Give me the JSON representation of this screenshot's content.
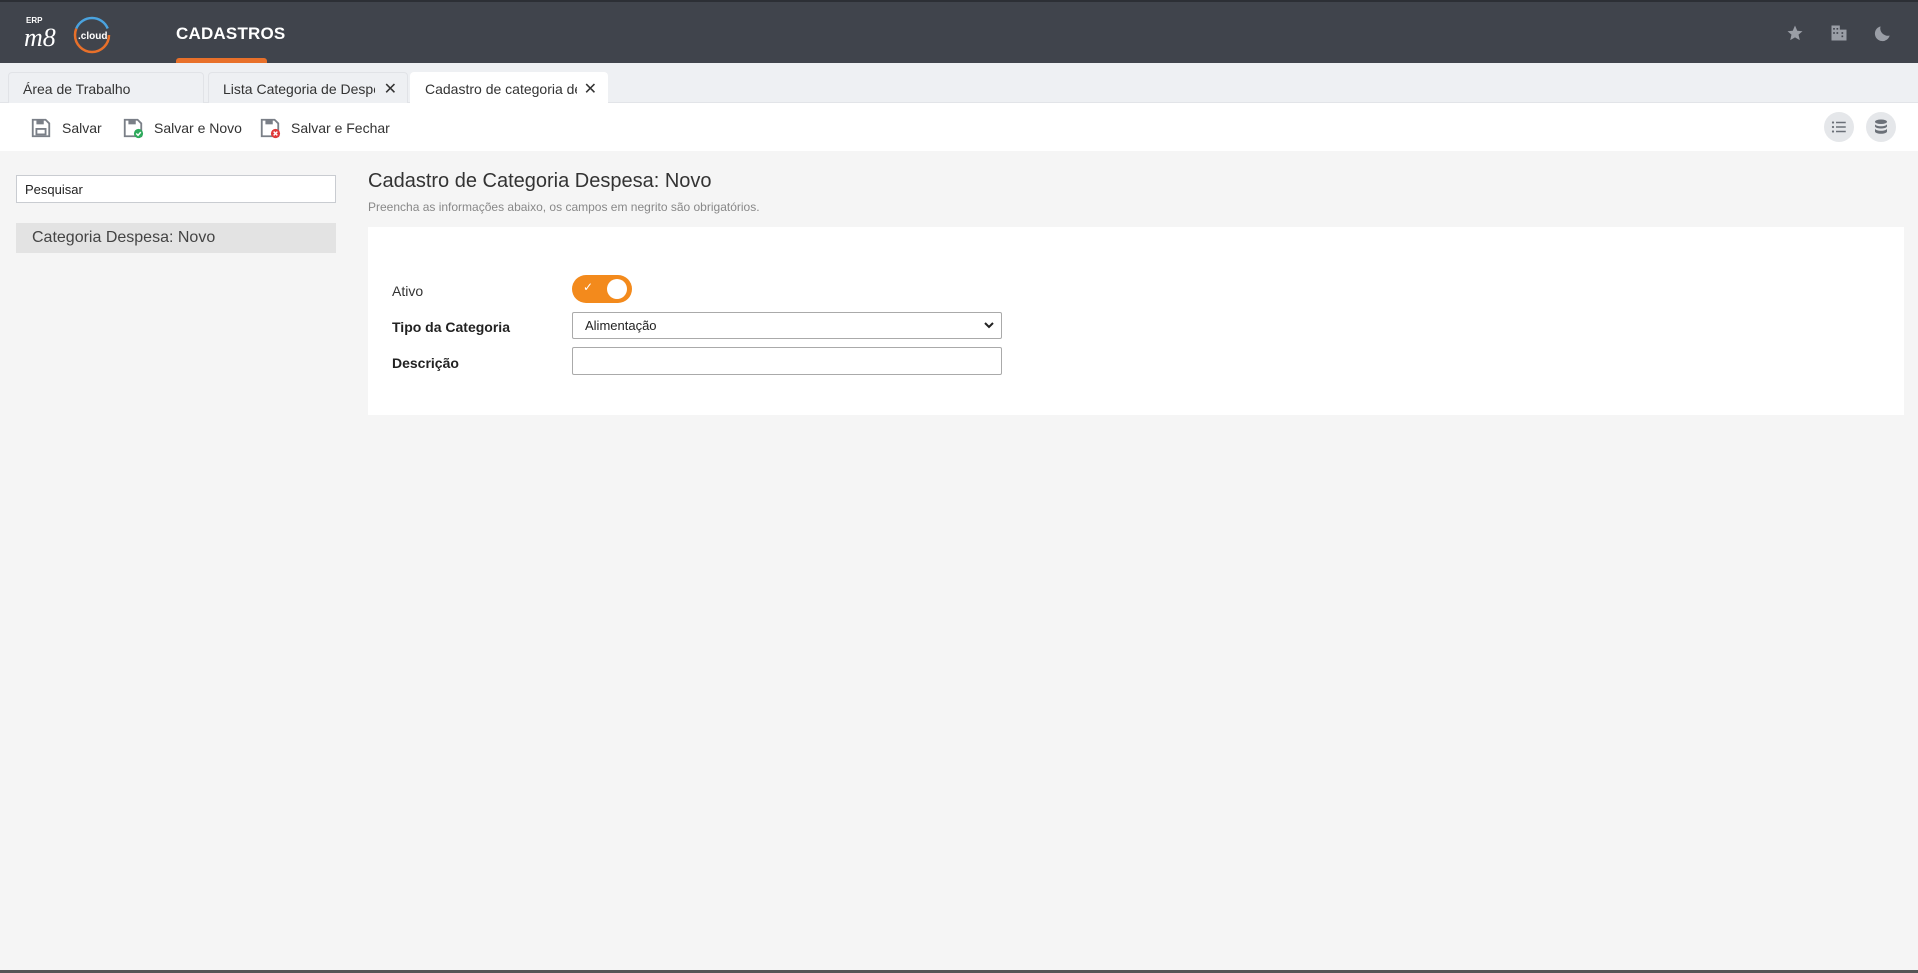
{
  "header": {
    "logo_erp": "ERP",
    "logo_m8": "m8",
    "logo_cloud": ".cloud",
    "menu_title": "CADASTROS",
    "accent_color": "#e8702a",
    "icons": [
      "star-icon",
      "building-icon",
      "moon-icon"
    ]
  },
  "tabs": [
    {
      "label": "Área de Trabalho",
      "closable": false
    },
    {
      "label": "Lista Categoria de Despesa",
      "closable": true
    },
    {
      "label": "Cadastro de categoria de despesa",
      "closable": true,
      "active": true
    }
  ],
  "toolbar": {
    "save_label": "Salvar",
    "save_new_label": "Salvar e Novo",
    "save_close_label": "Salvar e Fechar"
  },
  "sidebar": {
    "search_value": "Pesquisar",
    "items": [
      {
        "label": "Categoria Despesa: Novo"
      }
    ]
  },
  "main": {
    "title": "Cadastro de Categoria Despesa: Novo",
    "subtitle": "Preencha as informações abaixo, os campos em negrito são obrigatórios.",
    "form": {
      "ativo_label": "Ativo",
      "ativo_value": true,
      "ativo_check": "✓",
      "tipo_label": "Tipo da Categoria",
      "tipo_value": "Alimentação",
      "descricao_label": "Descrição",
      "descricao_value": ""
    }
  }
}
